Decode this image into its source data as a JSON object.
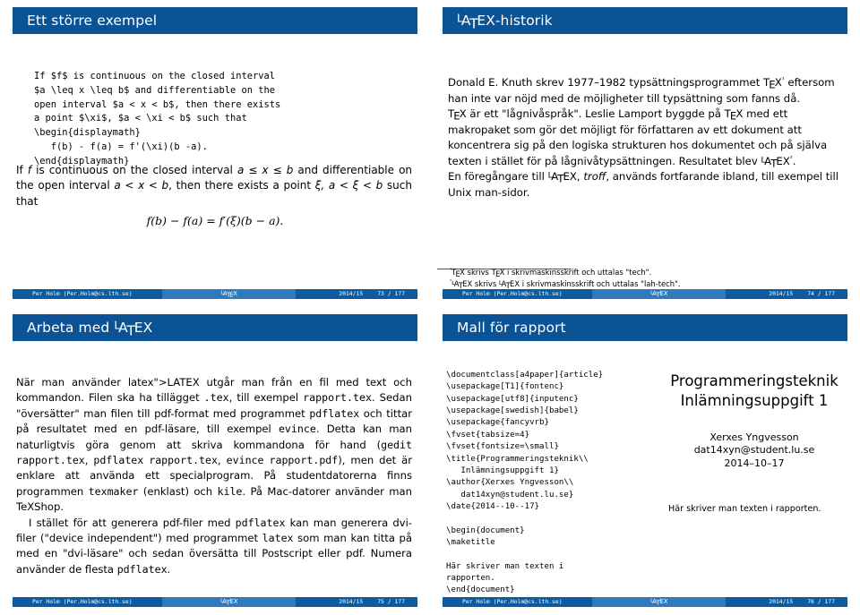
{
  "theme": {
    "title_bar_color": "#0b5394",
    "footer_dark": "#0c5ba0",
    "footer_mid": "#2f79bd",
    "text_color": "#000000",
    "background": "#ffffff"
  },
  "footer_common": {
    "author": "Per Holm  (Per.Holm@cs.lth.se)",
    "title": "LaTeX",
    "date": "2014/15",
    "total_pages": "177"
  },
  "slides": [
    {
      "id": "slide-ett-storre-exempel",
      "title": "Ett större exempel",
      "code": "If $f$ is continuous on the closed interval\n$a \\leq x \\leq b$ and differentiable on the\nopen interval $a < x < b$, then there exists\na point $\\xi$, $a < \\xi < b$ such that\n\\begin{displaymath}\n   f(b) - f(a) = f'(\\xi)(b -a).\n\\end{displaymath}",
      "paragraph_part1": "If ",
      "paragraph_f": "f",
      "paragraph_part2": " is continuous on the closed interval ",
      "paragraph_interval_closed": "a ≤ x ≤ b",
      "paragraph_part3": " and differentiable on the open interval ",
      "paragraph_interval_open": "a < x < b",
      "paragraph_part4": ", then there exists a point ",
      "paragraph_xi": "ξ, a < ξ < b",
      "paragraph_part5": " such that",
      "equation": "f(b) − f(a) = f′(ξ)(b − a).",
      "page_number": "73"
    },
    {
      "id": "slide-latex-historik",
      "title": "LaTeX-historik",
      "paragraphs": [
        "Donald E. Knuth skrev 1977–1982 typsättningsprogrammet TeX¹ eftersom han inte var nöjd med de möjligheter till typsättning som fanns då.",
        "TeX är ett \"lågnivåspråk\". Leslie Lamport byggde på TeX med ett makropaket som gör det möjligt för författaren av ett dokument att koncentrera sig på den logiska strukturen hos dokumentet och på själva texten i stället för på lågnivåtypsättningen. Resultatet blev LaTeX².",
        "En föregångare till LaTeX, troff, används fortfarande ibland, till exempel till Unix man-sidor."
      ],
      "footnotes": [
        "¹TeX skrivs TeX i skrivmaskinsskrift och uttalas \"tech\".",
        "²LaTeX skrivs LaTeX i skrivmaskinsskrift och uttalas \"lah-tech\"."
      ],
      "page_number": "74"
    },
    {
      "id": "slide-arbeta-med-latex",
      "title": "Arbeta med LaTeX",
      "paragraphs": [
        "När man använder LaTeX utgår man från en fil med text och kommandon. Filen ska ha tillägget .tex, till exempel rapport.tex. Sedan \"översätter\" man filen till pdf-format med programmet pdflatex och tittar på resultatet med en pdf-läsare, till exempel evince. Detta kan man naturligtvis göra genom att skriva kommandona för hand (gedit rapport.tex, pdflatex rapport.tex, evince rapport.pdf), men det är enklare att använda ett specialprogram. På studentdatorerna finns programmen texmaker (enklast) och kile. På Mac-datorer använder man TeXShop.",
        "I stället för att generera pdf-filer med pdflatex kan man generera dvi-filer (\"device independent\") med programmet latex som man kan titta på med en \"dvi-läsare\" och sedan översätta till Postscript eller pdf. Numera använder de flesta pdflatex."
      ],
      "page_number": "75"
    },
    {
      "id": "slide-mall-for-rapport",
      "title": "Mall för rapport",
      "code": "\\documentclass[a4paper]{article}\n\\usepackage[T1]{fontenc}\n\\usepackage[utf8]{inputenc}\n\\usepackage[swedish]{babel}\n\\usepackage{fancyvrb}\n\\fvset{tabsize=4}\n\\fvset{fontsize=\\small}\n\\title{Programmeringsteknik\\\\\n   Inlämningsuppgift 1}\n\\author{Xerxes Yngvesson\\\\\n   dat14xyn@student.lu.se}\n\\date{2014--10--17}\n\n\\begin{document}\n\\maketitle\n\nHär skriver man texten i\nrapporten.\n\\end{document}",
      "preview": {
        "title_line1": "Programmeringsteknik",
        "title_line2": "Inlämningsuppgift 1",
        "author": "Xerxes Yngvesson",
        "email": "dat14xyn@student.lu.se",
        "date": "2014–10–17",
        "body": "Här skriver man texten i rapporten."
      },
      "page_number": "76"
    }
  ]
}
